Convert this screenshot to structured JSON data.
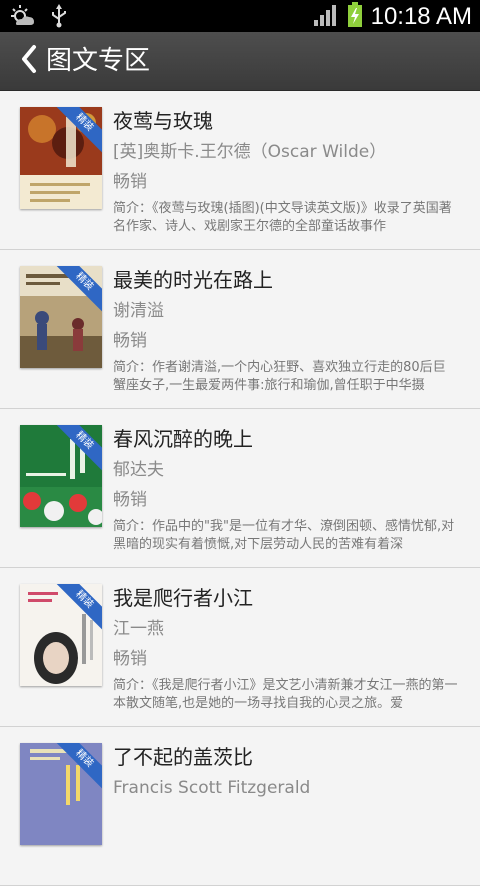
{
  "status_bar": {
    "time": "10:18 AM",
    "icons": [
      "weather-icon",
      "usb-icon",
      "signal-icon",
      "battery-charging-icon"
    ]
  },
  "header": {
    "back_icon": "chevron-left-icon",
    "title": "图文专区"
  },
  "books": [
    {
      "title": "夜莺与玫瑰",
      "author": "[英]奥斯卡.王尔德（Oscar Wilde）",
      "tag": "畅销",
      "badge": "精装",
      "summary": "简介：《夜莺与玫瑰(插图)(中文导读英文版)》收录了英国著名作家、诗人、戏剧家王尔德的全部童话故事作"
    },
    {
      "title": "最美的时光在路上",
      "author": "谢清溢",
      "tag": "畅销",
      "badge": "精装",
      "summary": "简介：作者谢清溢,一个内心狂野、喜欢独立行走的80后巨蟹座女子,一生最爱两件事:旅行和瑜伽,曾任职于中华摄"
    },
    {
      "title": "春风沉醉的晚上",
      "author": "郁达夫",
      "tag": "畅销",
      "badge": "精装",
      "summary": "简介：作品中的\"我\"是一位有才华、潦倒困顿、感情忧郁,对黑暗的现实有着愤慨,对下层劳动人民的苦难有着深"
    },
    {
      "title": "我是爬行者小江",
      "author": "江一燕",
      "tag": "畅销",
      "badge": "精装",
      "summary": "简介：《我是爬行者小江》是文艺小清新兼才女江一燕的第一本散文随笔,也是她的一场寻找自我的心灵之旅。爱"
    },
    {
      "title": "了不起的盖茨比",
      "author": "Francis Scott Fitzgerald",
      "tag": "",
      "badge": "精装",
      "summary": ""
    }
  ]
}
